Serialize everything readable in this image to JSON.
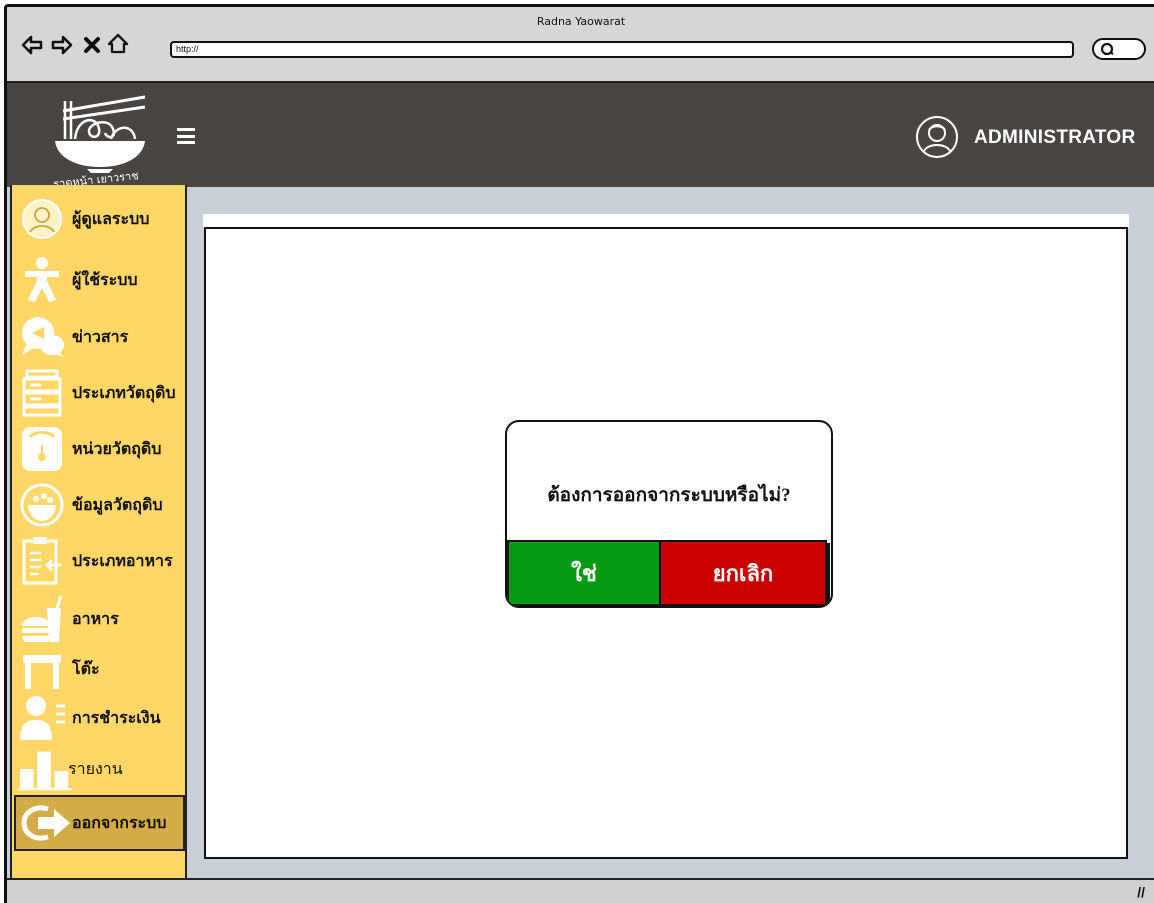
{
  "window": {
    "title": "Radna Yaowarat",
    "url": "http://"
  },
  "header": {
    "logo_text": "ราดหน้า เยาวราช",
    "user_label": "ADMINISTRATOR"
  },
  "sidebar": {
    "items": [
      {
        "label": "ผู้ดูแลระบบ",
        "icon": "admin-icon"
      },
      {
        "label": "ผู้ใช้ระบบ",
        "icon": "user-icon"
      },
      {
        "label": "ข่าวสาร",
        "icon": "news-icon"
      },
      {
        "label": "ประเภทวัตถุดิบ",
        "icon": "ingredient-type-icon"
      },
      {
        "label": "หน่วยวัตถุดิบ",
        "icon": "scale-icon"
      },
      {
        "label": "ข้อมูลวัตถุดิบ",
        "icon": "ingredient-info-icon"
      },
      {
        "label": "ประเภทอาหาร",
        "icon": "food-type-icon"
      },
      {
        "label": "อาหาร",
        "icon": "food-icon"
      },
      {
        "label": "โต๊ะ",
        "icon": "table-icon"
      },
      {
        "label": "การชำระเงิน",
        "icon": "payment-icon"
      },
      {
        "label": "รายงาน",
        "icon": "report-icon"
      },
      {
        "label": "ออกจากระบบ",
        "icon": "logout-icon",
        "active": true
      }
    ]
  },
  "dialog": {
    "message": "ต้องการออกจากระบบหรือไม่?",
    "confirm_label": "ใช่",
    "cancel_label": "ยกเลิก"
  },
  "colors": {
    "sidebar": "#fed766",
    "sidebar_active": "#d4ac45",
    "header": "#484543",
    "confirm": "#059c14",
    "cancel": "#cc0101",
    "background": "#c9cfd6"
  }
}
